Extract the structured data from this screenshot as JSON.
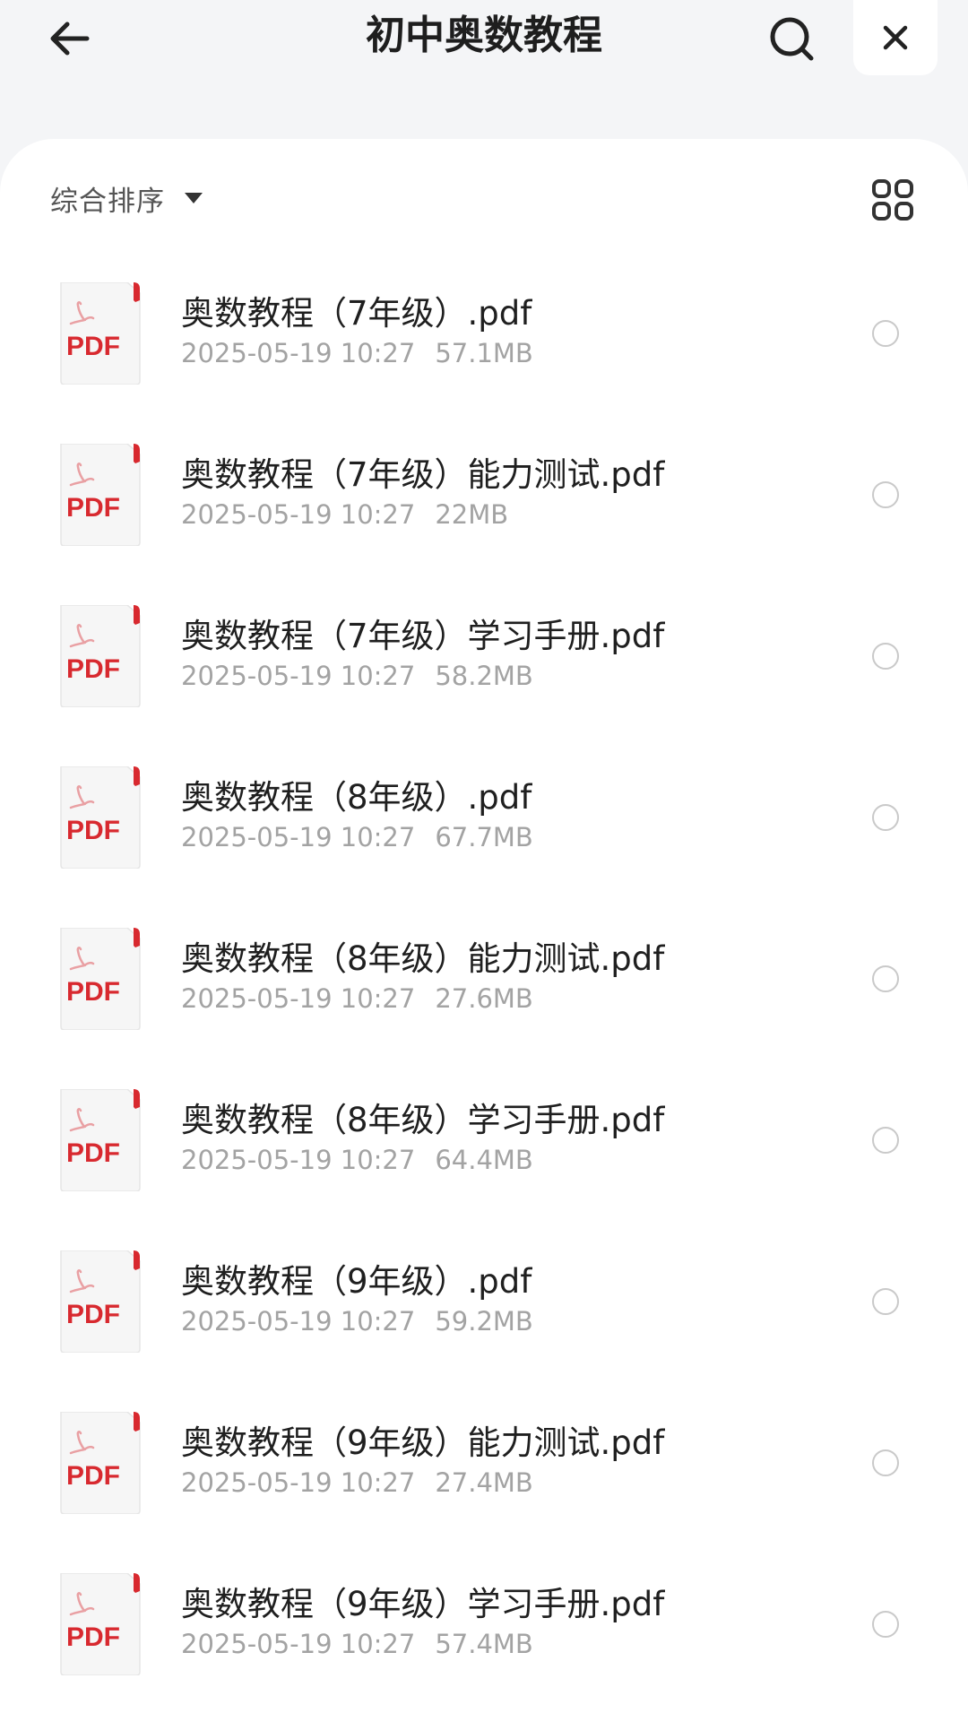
{
  "header": {
    "title": "初中奥数教程"
  },
  "toolbar": {
    "sort_label": "综合排序"
  },
  "icon_text": {
    "pdf": "PDF"
  },
  "files": [
    {
      "name": "奥数教程（7年级）.pdf",
      "date": "2025-05-19 10:27",
      "size": "57.1MB"
    },
    {
      "name": "奥数教程（7年级）能力测试.pdf",
      "date": "2025-05-19 10:27",
      "size": "22MB"
    },
    {
      "name": "奥数教程（7年级）学习手册.pdf",
      "date": "2025-05-19 10:27",
      "size": "58.2MB"
    },
    {
      "name": "奥数教程（8年级）.pdf",
      "date": "2025-05-19 10:27",
      "size": "67.7MB"
    },
    {
      "name": "奥数教程（8年级）能力测试.pdf",
      "date": "2025-05-19 10:27",
      "size": "27.6MB"
    },
    {
      "name": "奥数教程（8年级）学习手册.pdf",
      "date": "2025-05-19 10:27",
      "size": "64.4MB"
    },
    {
      "name": "奥数教程（9年级）.pdf",
      "date": "2025-05-19 10:27",
      "size": "59.2MB"
    },
    {
      "name": "奥数教程（9年级）能力测试.pdf",
      "date": "2025-05-19 10:27",
      "size": "27.4MB"
    },
    {
      "name": "奥数教程（9年级）学习手册.pdf",
      "date": "2025-05-19 10:27",
      "size": "57.4MB"
    }
  ],
  "icons": {
    "back": "arrow-left-icon",
    "search": "search-icon",
    "close": "close-icon",
    "sort_caret": "caret-down-icon",
    "view_toggle": "grid-view-icon",
    "file": "pdf-file-icon",
    "select": "radio-unchecked-icon"
  },
  "colors": {
    "page_background": "#f4f5f7",
    "panel_background": "#ffffff",
    "pdf_red": "#d8292f",
    "title_text": "#1e1e1e",
    "meta_text": "#a3a3a3"
  }
}
